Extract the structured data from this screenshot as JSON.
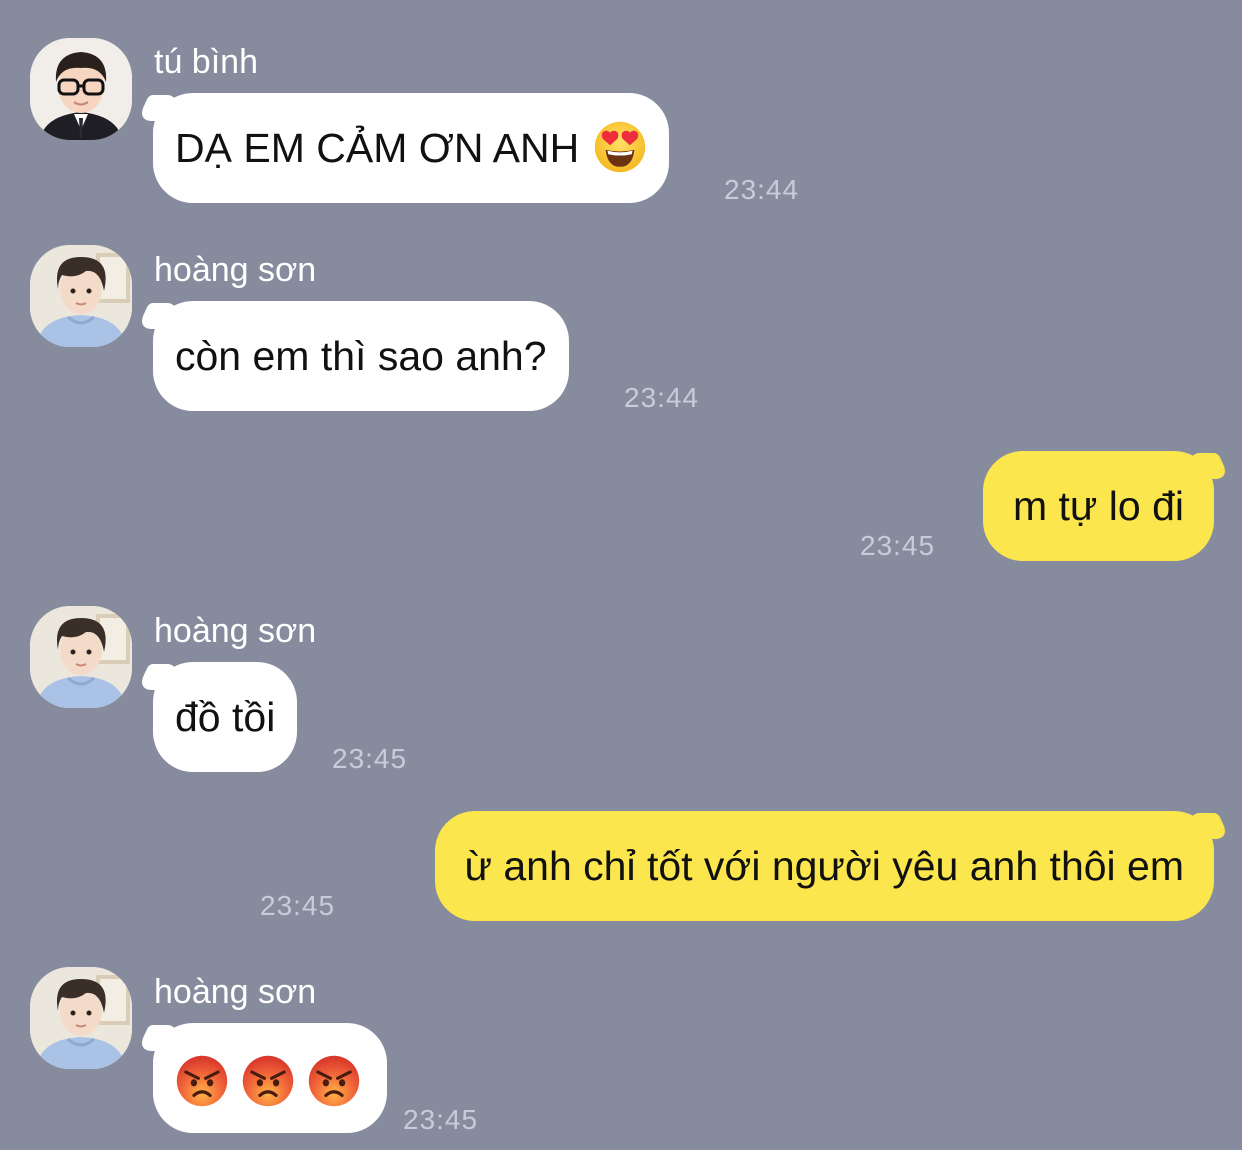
{
  "colors": {
    "background": "#868c9d",
    "incoming_bubble": "#ffffff",
    "outgoing_bubble": "#fbe64d",
    "timestamp": "#c7ccd8"
  },
  "messages": [
    {
      "direction": "incoming",
      "sender": "tú bình",
      "text": "DẠ EM CẢM ƠN ANH",
      "emoji": "heart-eyes-emoji",
      "time": "23:44"
    },
    {
      "direction": "incoming",
      "sender": "hoàng sơn",
      "text": "còn em thì sao anh?",
      "time": "23:44"
    },
    {
      "direction": "outgoing",
      "text": "m tự lo đi",
      "time": "23:45"
    },
    {
      "direction": "incoming",
      "sender": "hoàng sơn",
      "text": "đồ tồi",
      "time": "23:45"
    },
    {
      "direction": "outgoing",
      "text": "ừ anh chỉ tốt với người yêu anh thôi em",
      "time": "23:45"
    },
    {
      "direction": "incoming",
      "sender": "hoàng sơn",
      "emoji": [
        "angry-face-emoji",
        "angry-face-emoji",
        "angry-face-emoji"
      ],
      "time": "23:45"
    }
  ]
}
